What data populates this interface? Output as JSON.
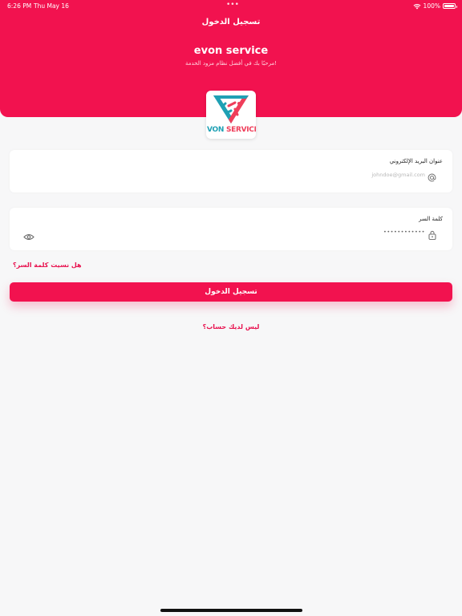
{
  "status_bar": {
    "time": "6:26 PM",
    "date": "Thu May 16",
    "battery_percent": "100%",
    "icons": [
      "wifi-icon",
      "battery-icon"
    ]
  },
  "header": {
    "title": "تسجيل الدخول",
    "app_name": "evon service",
    "subtitle": "مرحبًا بك في أفضل نظام مزود الخدمة!",
    "background_color": "#f2124f"
  },
  "logo": {
    "text_part1": "VON",
    "text_part2": "SERVICE",
    "colors": {
      "teal": "#1fa0b4",
      "coral": "#ef3e5a"
    }
  },
  "email_field": {
    "label": "عنوان البريد الإلكتروني",
    "placeholder": "johndoe@gmail.com",
    "icon": "at-sign-icon"
  },
  "password_field": {
    "label": "كلمة السر",
    "value": "••••••••••••",
    "icon": "lock-icon",
    "toggle_icon": "eye-icon"
  },
  "forgot_password": "هل نسيت كلمة السر؟",
  "login_button": "تسجيل الدخول",
  "signup_prompt": "ليس لديك حساب؟"
}
